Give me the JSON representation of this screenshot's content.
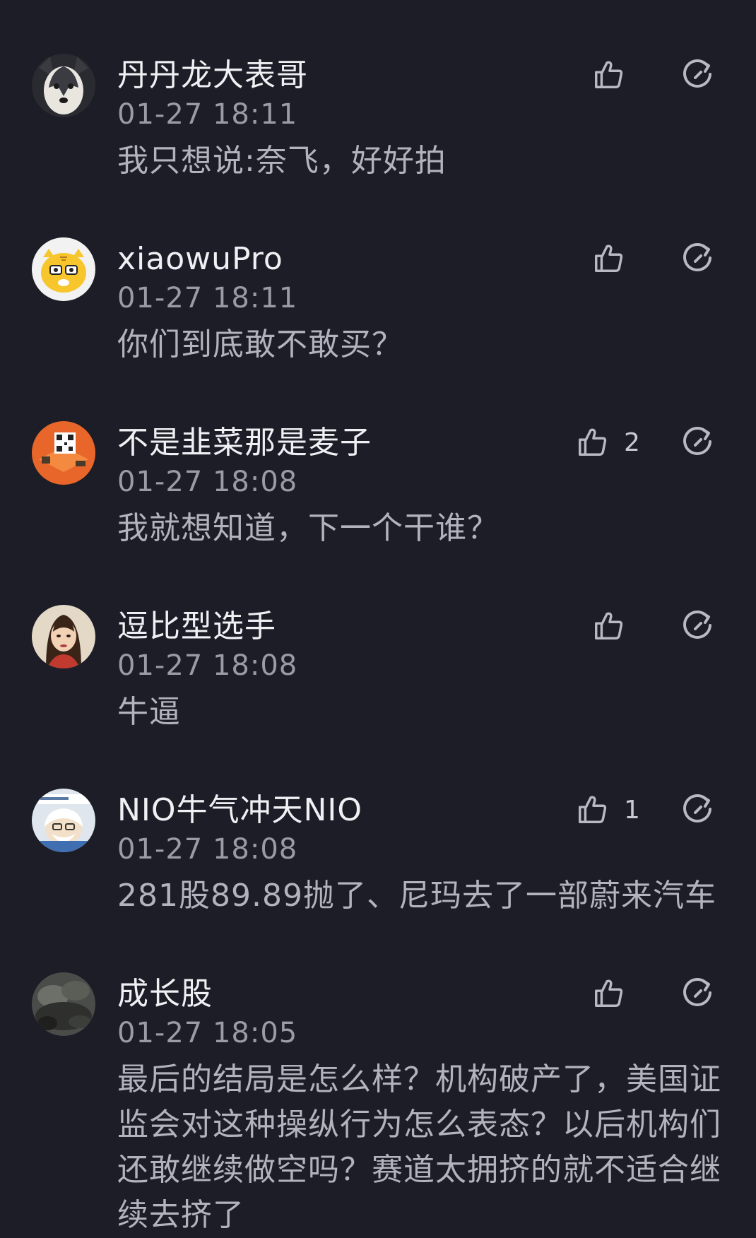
{
  "comments": [
    {
      "username": "丹丹龙大表哥",
      "time": "01-27 18:11",
      "text": "我只想说:奈飞，好好拍",
      "likes": "",
      "avatar": "husky-dog-avatar"
    },
    {
      "username": "xiaowuPro",
      "time": "01-27 18:11",
      "text": "你们到底敢不敢买？",
      "likes": "",
      "avatar": "tiger-avatar"
    },
    {
      "username": "不是韭菜那是麦子",
      "time": "01-27 18:08",
      "text": "我就想知道，下一个干谁？",
      "likes": "2",
      "avatar": "orange-game-avatar"
    },
    {
      "username": "逗比型选手",
      "time": "01-27 18:08",
      "text": "牛逼",
      "likes": "",
      "avatar": "woman-portrait-avatar"
    },
    {
      "username": "NIO牛气冲天NIO",
      "time": "01-27 18:08",
      "text": "281股89.89抛了、尼玛去了一部蔚来汽车",
      "likes": "1",
      "avatar": "cartoon-old-man-avatar"
    },
    {
      "username": "成长股",
      "time": "01-27 18:05",
      "text": "最后的结局是怎么样？机构破产了，美国证监会对这种操纵行为怎么表态？以后机构们还敢继续做空吗？赛道太拥挤的就不适合继续去挤了",
      "likes": "",
      "avatar": "dark-landscape-avatar"
    }
  ],
  "icons": {
    "like": "thumbs-up-icon",
    "reply": "reply-circle-icon"
  },
  "colors": {
    "background": "#1c1d26",
    "username": "#f0f0f4",
    "timestamp": "#9a9ba4",
    "text": "#b2b3bb",
    "icon": "#b8b9c1"
  }
}
